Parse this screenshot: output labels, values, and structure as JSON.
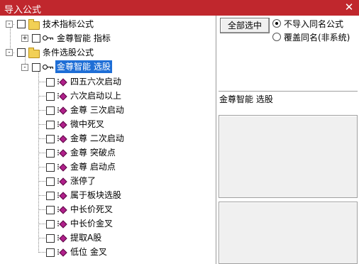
{
  "window": {
    "title": "导入公式",
    "close_glyph": "✕"
  },
  "tree": {
    "group1": {
      "label": "技术指标公式",
      "expander": "-",
      "item": {
        "label": "金尊智能 指标",
        "expander": "+"
      }
    },
    "group2": {
      "label": "条件选股公式",
      "expander": "-",
      "item": {
        "label": "金尊智能 选股",
        "expander": "-",
        "selected": true
      }
    },
    "leaves": [
      "四五六次启动",
      "六次启动以上",
      "金尊 三次启动",
      "微中死叉",
      "金尊 二次启动",
      "金尊 突破点",
      "金尊 启动点",
      "涨停了",
      "属于板块选股",
      "中长价死叉",
      "中长价金叉",
      "提取A股",
      "低位 金叉"
    ]
  },
  "right": {
    "select_all_label": "全部选中",
    "options": [
      {
        "label": "不导入同名公式",
        "checked": true
      },
      {
        "label": "覆盖同名(非系统)",
        "checked": false
      }
    ],
    "info_label": "金尊智能 选股"
  },
  "colors": {
    "titlebar": "#c0272d",
    "selection": "#1e6ed6",
    "leaf_icon": "#b0208a"
  }
}
